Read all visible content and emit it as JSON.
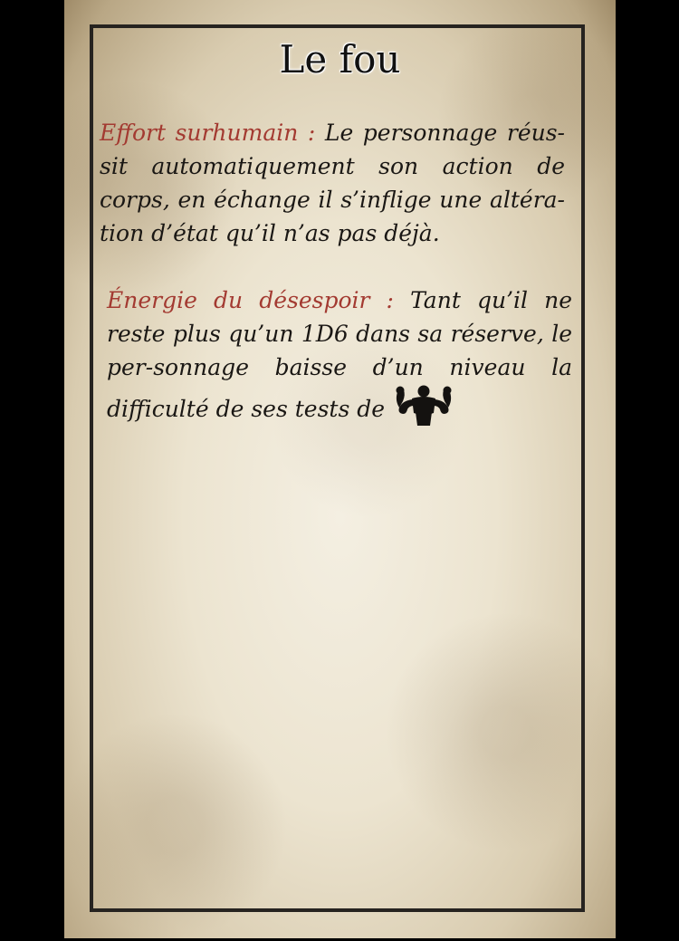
{
  "card": {
    "title": "Le fou",
    "abilities": [
      {
        "name": "Effort surhumain :",
        "text": "Le personnage réus-sit automatiquement son action de corps, en échange il s’inflige une altéra-tion d’état qu’il n’as pas déjà."
      },
      {
        "name": "Énergie du désespoir :",
        "text": "Tant qu’il ne reste plus qu’un 1D6 dans sa réserve, le per-sonnage baisse d’un niveau la difficulté de ses tests de",
        "icon": "muscle-strength-icon"
      }
    ]
  },
  "colors": {
    "ability_name": "#a33a31",
    "text": "#1a1714",
    "frame": "#262320"
  }
}
